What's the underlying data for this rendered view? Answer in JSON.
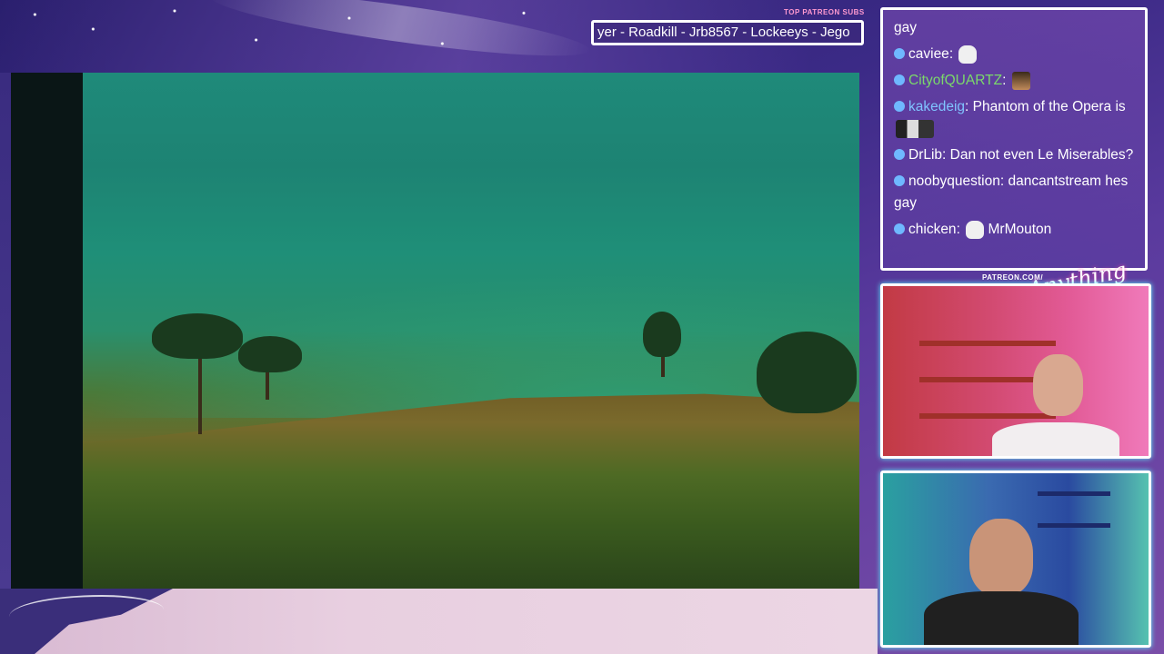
{
  "ticker": {
    "label": "TOP PATREON SUBS",
    "text": "yer - Roadkill - Jrb8567 - Lockeeys - Jego"
  },
  "chat": {
    "messages": [
      {
        "user": "",
        "text": "gay",
        "emotes": []
      },
      {
        "user": "caviee",
        "text": "",
        "emotes": [
          "cat-emote"
        ]
      },
      {
        "user": "CityofQUARTZ",
        "text": "",
        "emotes": [
          "face-emote"
        ]
      },
      {
        "user": "kakedeig",
        "text": "Phantom of the Opera is",
        "emotes": [
          "strip-emote"
        ]
      },
      {
        "user": "DrLib",
        "text": "Dan not even Le Miserables?",
        "emotes": []
      },
      {
        "user": "noobyquestion",
        "text": "dancantstream hes gay",
        "emotes": []
      },
      {
        "user": "chicken",
        "text": "MrMouton",
        "emotes": [
          "cat-emote"
        ]
      }
    ]
  },
  "branding": {
    "patreon_url": "PATREON.COM/",
    "logo_text": "Anything Else"
  },
  "colors": {
    "accent_pink": "#ff9ad0",
    "chat_green": "#7bd96a",
    "chat_blue": "#7fc4ff",
    "cam_glow": "#5ff3ff"
  }
}
